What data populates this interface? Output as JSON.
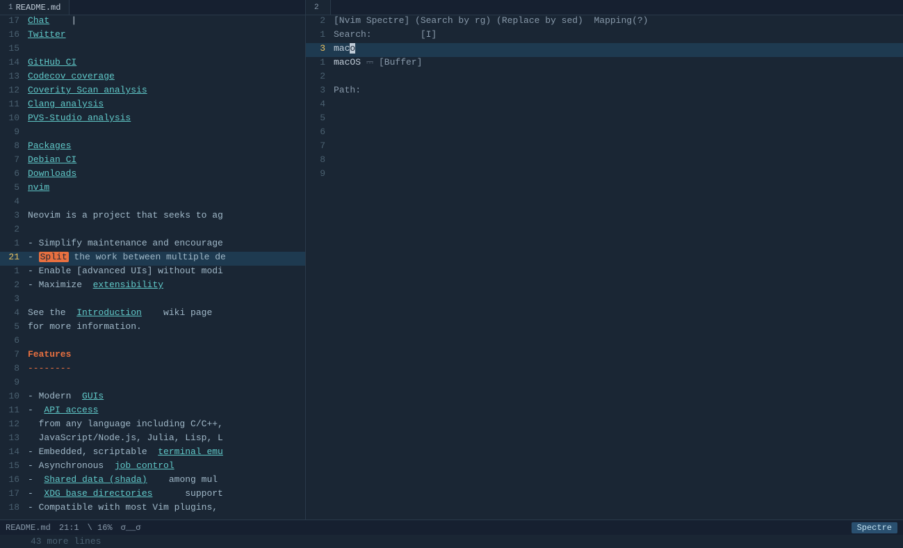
{
  "tabs": {
    "left": [
      {
        "number": "1",
        "label": "README.md",
        "active": true
      }
    ],
    "right": [
      {
        "number": "2",
        "label": "",
        "active": true
      }
    ]
  },
  "left_pane": {
    "lines": [
      {
        "num": "17",
        "content": "Chat",
        "type": "link_line",
        "link": "Chat",
        "extra": "    |"
      },
      {
        "num": "16",
        "content": "Twitter",
        "type": "link_line",
        "link": "Twitter"
      },
      {
        "num": "15",
        "content": "",
        "type": "empty"
      },
      {
        "num": "14",
        "content": "GitHub CI",
        "type": "link_line",
        "link": "GitHub CI"
      },
      {
        "num": "13",
        "content": "Codecov coverage",
        "type": "link_line",
        "link": "Codecov coverage"
      },
      {
        "num": "12",
        "content": "Coverity Scan analysis",
        "type": "link_line",
        "link": "Coverity Scan analysis"
      },
      {
        "num": "11",
        "content": "Clang analysis",
        "type": "link_line",
        "link": "Clang analysis"
      },
      {
        "num": "10",
        "content": "PVS-Studio analysis",
        "type": "link_line",
        "link": "PVS-Studio analysis"
      },
      {
        "num": "9",
        "content": "",
        "type": "empty"
      },
      {
        "num": "8",
        "content": "Packages",
        "type": "link_line",
        "link": "Packages"
      },
      {
        "num": "7",
        "content": "Debian CI",
        "type": "link_line",
        "link": "Debian CI"
      },
      {
        "num": "6",
        "content": "Downloads",
        "type": "link_line",
        "link": "Downloads"
      },
      {
        "num": "5",
        "content": "nvim",
        "type": "link_line",
        "link": "nvim"
      },
      {
        "num": "4",
        "content": "",
        "type": "empty"
      },
      {
        "num": "3",
        "content": "Neovim is a project that seeks to ag",
        "type": "text"
      },
      {
        "num": "2",
        "content": "",
        "type": "empty"
      },
      {
        "num": "1",
        "content": "- Simplify maintenance and encourage",
        "type": "bullet"
      },
      {
        "num": "21",
        "content": "- Split the work between multiple de",
        "type": "bullet_highlight",
        "active": true
      },
      {
        "num": "1",
        "content": "- Enable [advanced UIs] without modi",
        "type": "bullet"
      },
      {
        "num": "2",
        "content": "- Maximize  extensibility",
        "type": "bullet_link",
        "link": "extensibility"
      },
      {
        "num": "3",
        "content": "",
        "type": "empty"
      },
      {
        "num": "4",
        "content": "See the  Introduction    wiki page",
        "type": "text_link",
        "link": "Introduction"
      },
      {
        "num": "5",
        "content": "for more information.",
        "type": "text"
      },
      {
        "num": "6",
        "content": "",
        "type": "empty"
      },
      {
        "num": "7",
        "content": "Features",
        "type": "heading"
      },
      {
        "num": "8",
        "content": "--------",
        "type": "dashes"
      },
      {
        "num": "9",
        "content": "",
        "type": "empty"
      },
      {
        "num": "10",
        "content": "- Modern  GUIs",
        "type": "bullet_link",
        "link": "GUIs"
      },
      {
        "num": "11",
        "content": "-  API access",
        "type": "bullet_link2",
        "link": "API access"
      },
      {
        "num": "12",
        "content": "  from any language including C/C++,",
        "type": "text_indent"
      },
      {
        "num": "13",
        "content": "  JavaScript/Node.js, Julia, Lisp, L",
        "type": "text_indent"
      },
      {
        "num": "14",
        "content": "- Embedded, scriptable  terminal emu",
        "type": "bullet_link3",
        "link": "terminal emu"
      },
      {
        "num": "15",
        "content": "- Asynchronous  job control",
        "type": "bullet_link4",
        "link": "job control"
      },
      {
        "num": "16",
        "content": "-  Shared data (shada)    among mul",
        "type": "bullet_link5",
        "link": "Shared data (shada)"
      },
      {
        "num": "17",
        "content": "-  XDG base directories      support",
        "type": "bullet_link6",
        "link": "XDG base directories"
      },
      {
        "num": "18",
        "content": "- Compatible with most Vim plugins,",
        "type": "bullet"
      }
    ]
  },
  "right_pane": {
    "lines": [
      {
        "num": "2",
        "content": "[Nvim Spectre] (Search by rg) (Replace by sed)  Mapping(?)",
        "type": "info"
      },
      {
        "num": "1",
        "content": "Search:         [I]",
        "type": "label"
      },
      {
        "num": "3",
        "content": "maco",
        "type": "search_input",
        "cursor": true,
        "active": true
      },
      {
        "num": "1",
        "content": "macOS ⎓ [Buffer]",
        "type": "result"
      },
      {
        "num": "2",
        "content": "",
        "type": "empty"
      },
      {
        "num": "3",
        "content": "Path:",
        "type": "label2"
      },
      {
        "num": "4",
        "content": "",
        "type": "empty"
      },
      {
        "num": "5",
        "content": "",
        "type": "empty"
      },
      {
        "num": "6",
        "content": "",
        "type": "empty"
      },
      {
        "num": "7",
        "content": "",
        "type": "empty"
      },
      {
        "num": "8",
        "content": "",
        "type": "empty"
      },
      {
        "num": "9",
        "content": "",
        "type": "empty"
      }
    ]
  },
  "statusbar": {
    "filename": "README.md",
    "position": "21:1",
    "scroll": "\\ 16%",
    "mode": "σ__σ",
    "plugin": "Spectre"
  },
  "more_lines": "43 more lines"
}
